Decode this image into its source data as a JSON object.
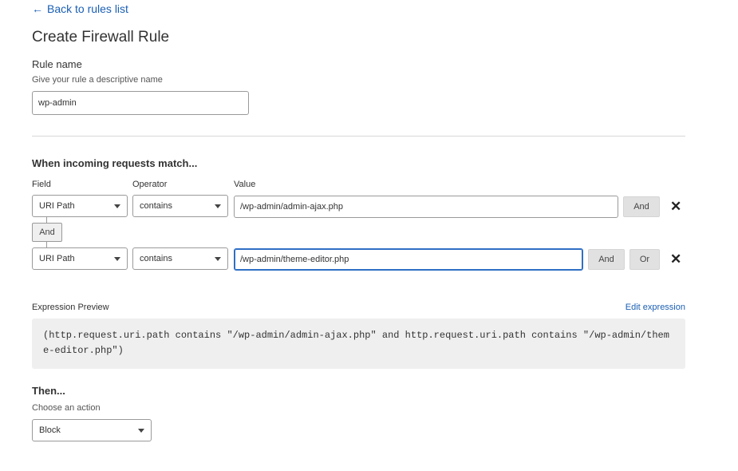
{
  "nav": {
    "back_label": "Back to rules list"
  },
  "page": {
    "title": "Create Firewall Rule"
  },
  "rule_name": {
    "label": "Rule name",
    "hint": "Give your rule a descriptive name",
    "value": "wp-admin"
  },
  "match": {
    "title": "When incoming requests match...",
    "field_header": "Field",
    "operator_header": "Operator",
    "value_header": "Value",
    "connector_label": "And",
    "rows": [
      {
        "field": "URI Path",
        "operator": "contains",
        "value": "/wp-admin/admin-ajax.php",
        "and_label": "And"
      },
      {
        "field": "URI Path",
        "operator": "contains",
        "value": "/wp-admin/theme-editor.php",
        "and_label": "And",
        "or_label": "Or"
      }
    ]
  },
  "preview": {
    "label": "Expression Preview",
    "edit_label": "Edit expression",
    "expression": "(http.request.uri.path contains \"/wp-admin/admin-ajax.php\" and http.request.uri.path contains \"/wp-admin/theme-editor.php\")"
  },
  "action": {
    "title": "Then...",
    "hint": "Choose an action",
    "selected": "Block"
  },
  "colors": {
    "link": "#1a5fb4",
    "focus": "#2f6fc4",
    "button_bg": "#e1e1e1",
    "preview_bg": "#efefef"
  }
}
